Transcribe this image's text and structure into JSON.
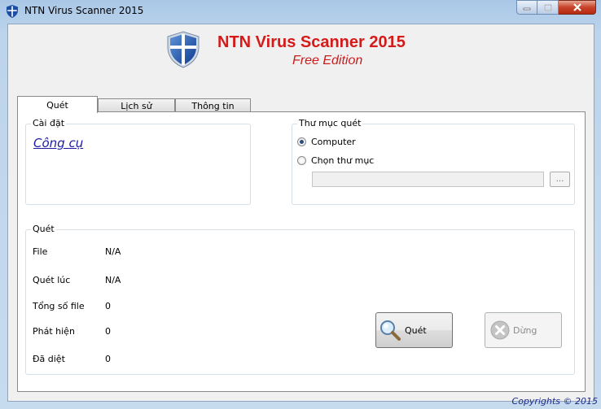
{
  "window": {
    "title": "NTN Virus Scanner 2015",
    "controls": {
      "minimize": "minimize-icon",
      "maximize": "maximize-icon",
      "close": "close-icon"
    }
  },
  "header": {
    "title": "NTN Virus Scanner 2015",
    "subtitle": "Free Edition",
    "logo": "shield-icon"
  },
  "tabs": [
    {
      "label": "Quét",
      "active": true
    },
    {
      "label": "Lịch sử",
      "active": false
    },
    {
      "label": "Thông tin",
      "active": false
    }
  ],
  "settings": {
    "group_label": "Cài đặt",
    "tools_link": "Công cụ"
  },
  "scan_folder": {
    "group_label": "Thư mục quét",
    "options": [
      {
        "label": "Computer",
        "selected": true
      },
      {
        "label": "Chọn thư mục",
        "selected": false
      }
    ],
    "path_value": "",
    "browse_label": "..."
  },
  "scan": {
    "group_label": "Quét",
    "rows": [
      {
        "label": "File",
        "value": "N/A"
      },
      {
        "label": "Quét lúc",
        "value": "N/A"
      },
      {
        "label": "Tổng số file",
        "value": "0"
      },
      {
        "label": "Phát hiện",
        "value": "0"
      },
      {
        "label": "Đã diệt",
        "value": "0"
      }
    ],
    "scan_button": "Quét",
    "stop_button": "Dừng"
  },
  "footer": {
    "copyright": "Copyrights © 2015"
  },
  "colors": {
    "title_red": "#d51a1a",
    "link_blue": "#1a1aa6",
    "copyright_blue": "#1a2a8a"
  }
}
